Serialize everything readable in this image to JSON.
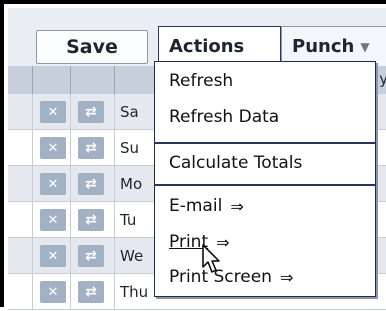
{
  "toolbar": {
    "save_label": "Save",
    "tabs": [
      {
        "label": "Actions"
      },
      {
        "label": "Punch"
      }
    ]
  },
  "menu": {
    "items": [
      {
        "label": "Refresh"
      },
      {
        "label": "Refresh Data"
      },
      {
        "label": "Calculate Totals"
      },
      {
        "label": "E-mail",
        "arrow": "⇒"
      },
      {
        "label": "Print",
        "arrow": "⇒"
      },
      {
        "label": "Print Screen",
        "arrow": "⇒"
      }
    ]
  },
  "grid": {
    "header_fragment": "ay",
    "rows": [
      {
        "day": "Sa"
      },
      {
        "day": "Su"
      },
      {
        "day": "Mo"
      },
      {
        "day": "Tu"
      },
      {
        "day": "We"
      },
      {
        "day": "Thu 8/21"
      }
    ]
  },
  "icons": {
    "delete": "✕",
    "edit": "⇄"
  }
}
